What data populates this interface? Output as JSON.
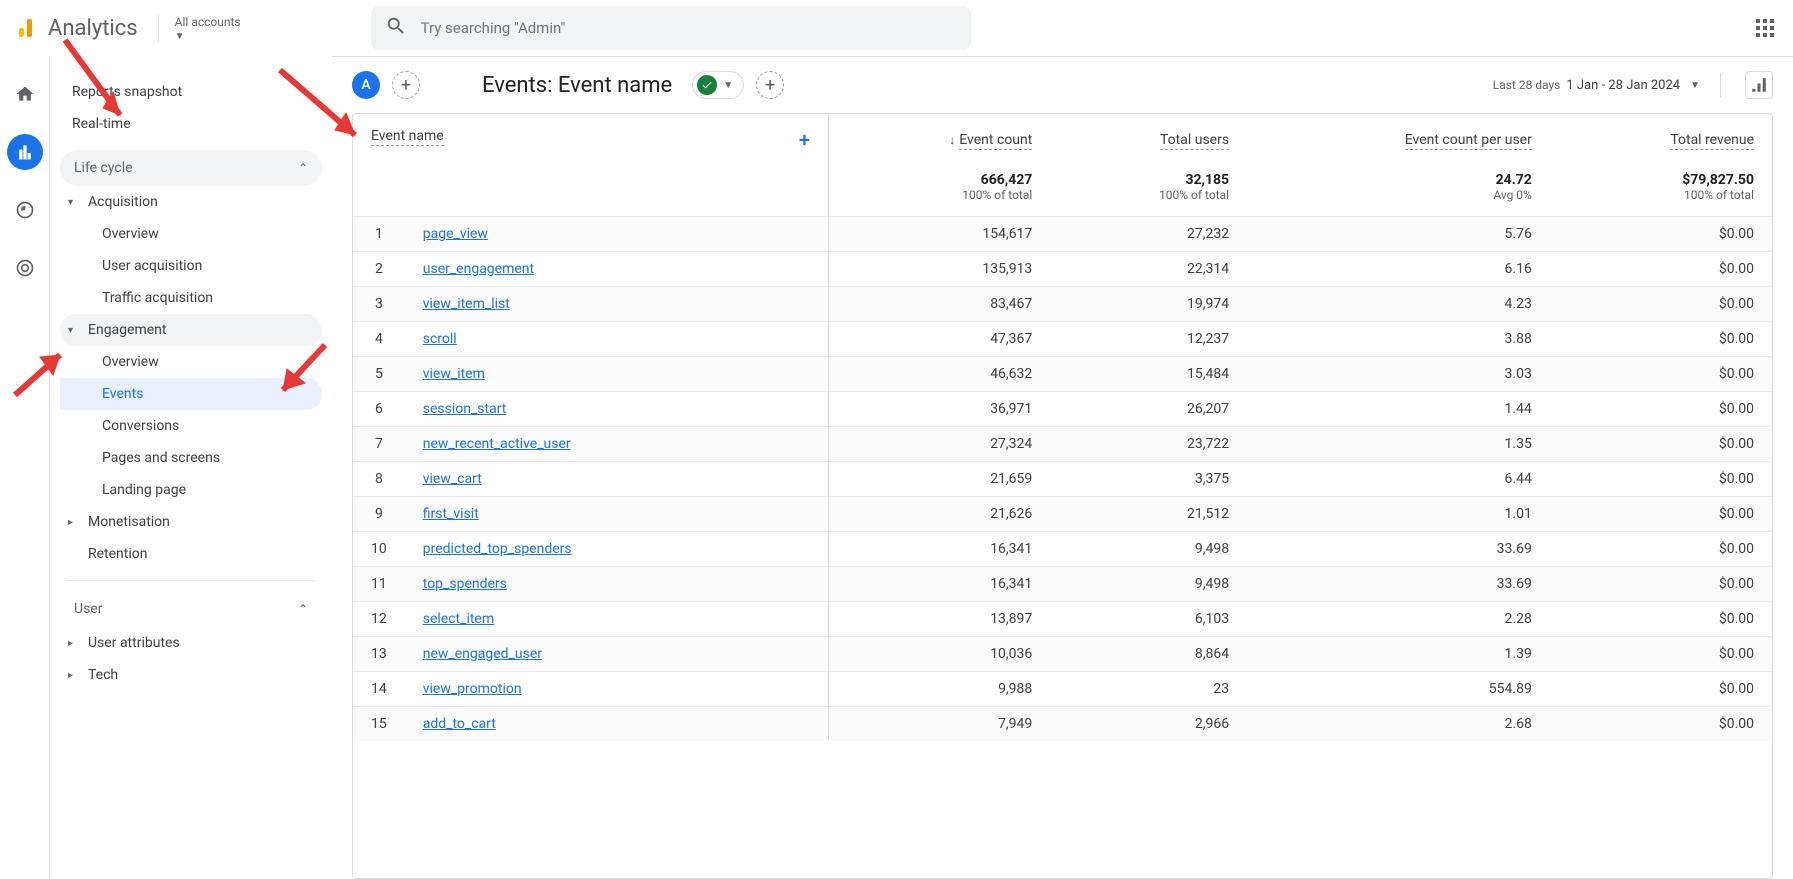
{
  "header": {
    "product": "Analytics",
    "accounts_label": "All accounts",
    "search_placeholder": "Try searching \"Admin\""
  },
  "sidebar": {
    "reports_snapshot": "Reports snapshot",
    "realtime": "Real-time",
    "lifecycle_label": "Life cycle",
    "acquisition": {
      "label": "Acquisition",
      "overview": "Overview",
      "user_acq": "User acquisition",
      "traffic_acq": "Traffic acquisition"
    },
    "engagement": {
      "label": "Engagement",
      "overview": "Overview",
      "events": "Events",
      "conversions": "Conversions",
      "pages": "Pages and screens",
      "landing": "Landing page"
    },
    "monetisation": "Monetisation",
    "retention": "Retention",
    "user_label": "User",
    "user_attributes": "User attributes",
    "tech": "Tech"
  },
  "content": {
    "badge": "A",
    "title": "Events: Event name",
    "date_label": "Last 28 days",
    "date_range": "1 Jan - 28 Jan 2024"
  },
  "table": {
    "columns": {
      "name": "Event name",
      "count": "Event count",
      "users": "Total users",
      "per_user": "Event count per user",
      "revenue": "Total revenue"
    },
    "totals": {
      "count": "666,427",
      "count_sub": "100% of total",
      "users": "32,185",
      "users_sub": "100% of total",
      "per_user": "24.72",
      "per_user_sub": "Avg 0%",
      "revenue": "$79,827.50",
      "revenue_sub": "100% of total"
    },
    "rows": [
      {
        "idx": "1",
        "name": "page_view",
        "count": "154,617",
        "users": "27,232",
        "per_user": "5.76",
        "revenue": "$0.00"
      },
      {
        "idx": "2",
        "name": "user_engagement",
        "count": "135,913",
        "users": "22,314",
        "per_user": "6.16",
        "revenue": "$0.00"
      },
      {
        "idx": "3",
        "name": "view_item_list",
        "count": "83,467",
        "users": "19,974",
        "per_user": "4.23",
        "revenue": "$0.00"
      },
      {
        "idx": "4",
        "name": "scroll",
        "count": "47,367",
        "users": "12,237",
        "per_user": "3.88",
        "revenue": "$0.00"
      },
      {
        "idx": "5",
        "name": "view_item",
        "count": "46,632",
        "users": "15,484",
        "per_user": "3.03",
        "revenue": "$0.00"
      },
      {
        "idx": "6",
        "name": "session_start",
        "count": "36,971",
        "users": "26,207",
        "per_user": "1.44",
        "revenue": "$0.00"
      },
      {
        "idx": "7",
        "name": "new_recent_active_user",
        "count": "27,324",
        "users": "23,722",
        "per_user": "1.35",
        "revenue": "$0.00"
      },
      {
        "idx": "8",
        "name": "view_cart",
        "count": "21,659",
        "users": "3,375",
        "per_user": "6.44",
        "revenue": "$0.00"
      },
      {
        "idx": "9",
        "name": "first_visit",
        "count": "21,626",
        "users": "21,512",
        "per_user": "1.01",
        "revenue": "$0.00"
      },
      {
        "idx": "10",
        "name": "predicted_top_spenders",
        "count": "16,341",
        "users": "9,498",
        "per_user": "33.69",
        "revenue": "$0.00"
      },
      {
        "idx": "11",
        "name": "top_spenders",
        "count": "16,341",
        "users": "9,498",
        "per_user": "33.69",
        "revenue": "$0.00"
      },
      {
        "idx": "12",
        "name": "select_item",
        "count": "13,897",
        "users": "6,103",
        "per_user": "2.28",
        "revenue": "$0.00"
      },
      {
        "idx": "13",
        "name": "new_engaged_user",
        "count": "10,036",
        "users": "8,864",
        "per_user": "1.39",
        "revenue": "$0.00"
      },
      {
        "idx": "14",
        "name": "view_promotion",
        "count": "9,988",
        "users": "23",
        "per_user": "554.89",
        "revenue": "$0.00"
      },
      {
        "idx": "15",
        "name": "add_to_cart",
        "count": "7,949",
        "users": "2,966",
        "per_user": "2.68",
        "revenue": "$0.00"
      }
    ]
  }
}
